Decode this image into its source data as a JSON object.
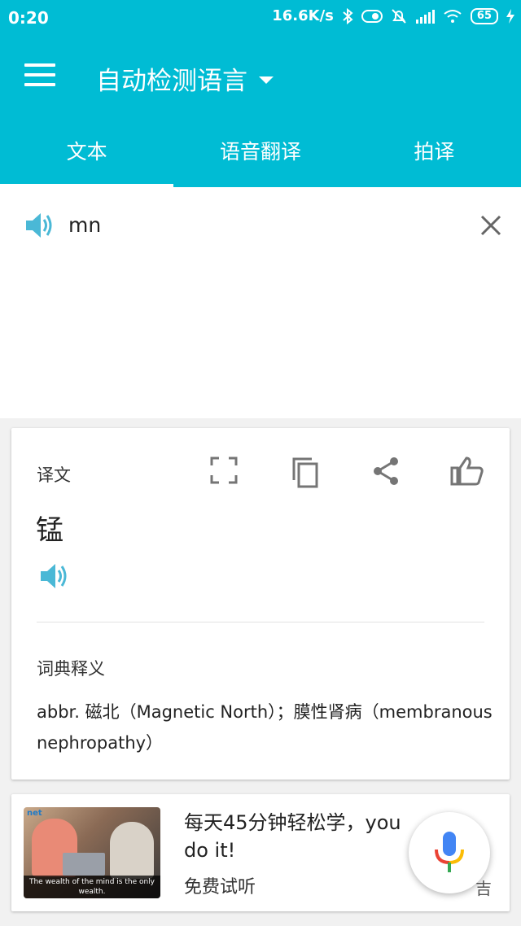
{
  "status_bar": {
    "time": "0:20",
    "net_speed": "16.6K/s",
    "battery": "65"
  },
  "header": {
    "language": "自动检测语言"
  },
  "tabs": [
    {
      "label": "文本"
    },
    {
      "label": "语音翻译"
    },
    {
      "label": "拍译"
    }
  ],
  "input": {
    "text": "mn"
  },
  "result": {
    "label": "译文",
    "translation": "锰",
    "dict_label": "词典释义",
    "definition": "abbr. 磁北（Magnetic North）；膜性肾病（membranous nephropathy）"
  },
  "ad": {
    "title": "每天45分钟轻松学，you do it!",
    "subtitle": "免费试听",
    "tag": "吉",
    "image_brand": "net",
    "image_caption": "The wealth of the mind is the only wealth."
  },
  "colors": {
    "primary": "#00bcd4",
    "speaker": "#4ab8d6",
    "icon_gray": "#757575"
  }
}
